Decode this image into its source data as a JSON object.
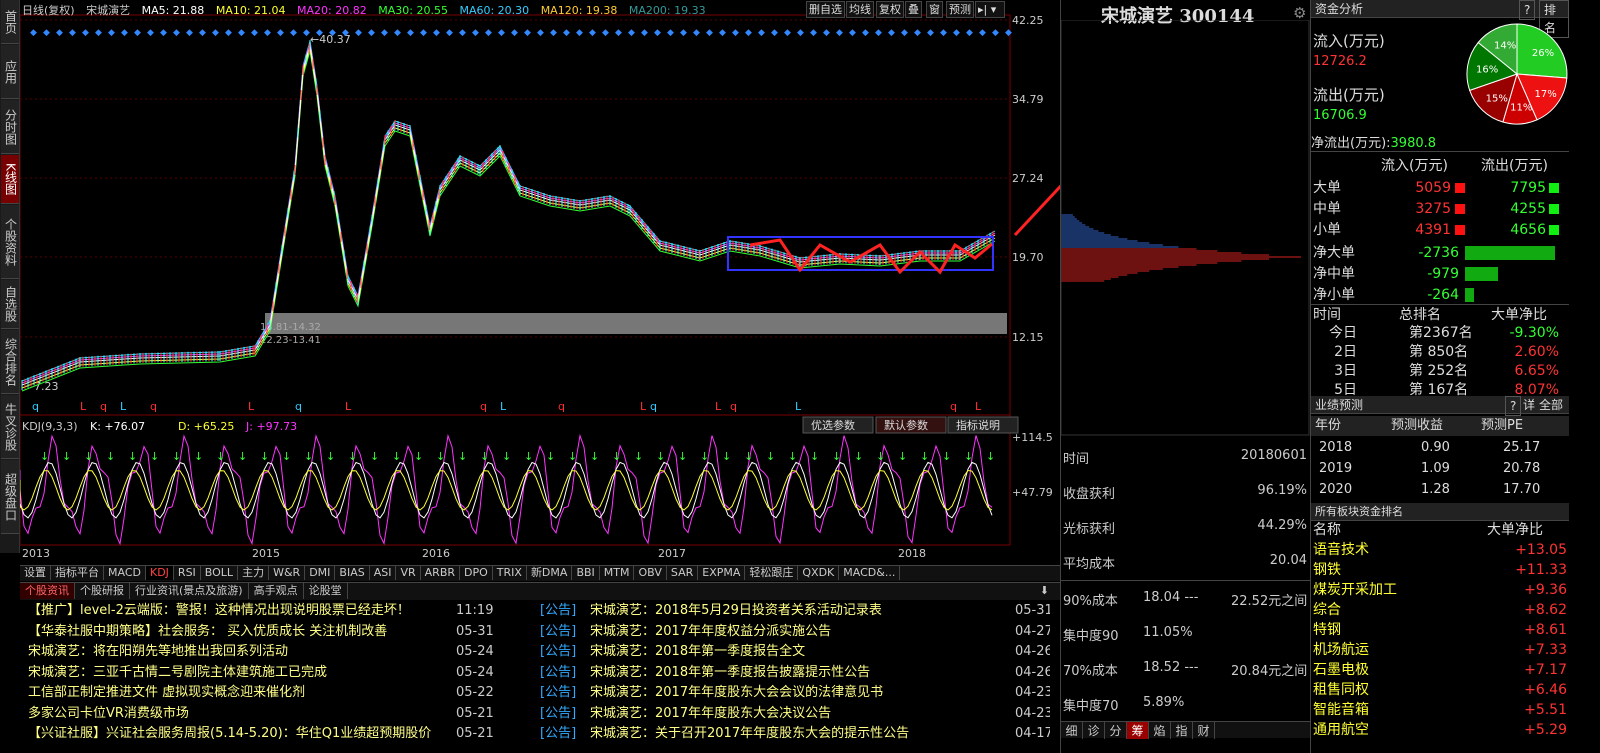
{
  "nav": [
    "首页",
    "应用",
    "分时图",
    "K线图",
    "个股资料",
    "自选股",
    "综合排名",
    "牛叉诊股",
    "超级盘口"
  ],
  "header": {
    "period": "日线(复权)",
    "name": "宋城演艺",
    "ma5": "MA5: 21.88",
    "ma10": "MA10: 21.04",
    "ma20": "MA20: 20.82",
    "ma30": "MA30: 20.55",
    "ma60": "MA60: 20.30",
    "ma120": "MA120: 19.38",
    "ma200": "MA200: 19.33"
  },
  "toolbar": [
    "删自选",
    "均线",
    "复权",
    "叠",
    "窗",
    "预测"
  ],
  "yaxis": [
    "42.25",
    "34.79",
    "27.24",
    "19.70",
    "12.15"
  ],
  "ylabels": {
    "high": "40.37",
    "low": "7.23",
    "gap1": "13.81-14.32",
    "gap2": "12.23-13.41"
  },
  "xaxis": [
    "2013",
    "2015",
    "2016",
    "2017",
    "2018"
  ],
  "kdj": {
    "title": "KDJ(9,3,3)",
    "k": "K: +76.07",
    "d": "D: +65.25",
    "j": "J: +97.73",
    "y1": "+114.5",
    "y2": "+47.79",
    "btn1": "优选参数",
    "btn2": "默认参数",
    "btn3": "指标说明"
  },
  "tabs": [
    "设置",
    "指标平台",
    "MACD",
    "KDJ",
    "RSI",
    "BOLL",
    "主力",
    "W&R",
    "DMI",
    "BIAS",
    "ASI",
    "VR",
    "ARBR",
    "DPO",
    "TRIX",
    "新DMA",
    "BBI",
    "MTM",
    "OBV",
    "SAR",
    "EXPMA",
    "轻松跟庄",
    "QXDK",
    "MACD&..."
  ],
  "newstabs": [
    "个股资讯",
    "个股研报",
    "行业资讯(景点及旅游)",
    "高手观点",
    "论股堂"
  ],
  "news_left": [
    {
      "title": "【推广】level-2云端版：警报！这种情况出现说明股票已经走坏！",
      "time": "11:19"
    },
    {
      "title": "【华泰社服中期策略】社会服务： 买入优质成长 关注机制改善",
      "time": "05-31"
    },
    {
      "title": "宋城演艺：将在阳朔先等地推出我回系列活动",
      "time": "05-24"
    },
    {
      "title": "宋城演艺：三亚千古情二号剧院主体建筑施工已完成",
      "time": "05-24"
    },
    {
      "title": "工信部正制定推进文件 虚拟现实概念迎来催化剂",
      "time": "05-22"
    },
    {
      "title": "多家公司卡位VR消费级市场",
      "time": "05-21"
    },
    {
      "title": "【兴证社服】兴证社会服务周报(5.14-5.20)：华住Q1业绩超预期股价",
      "time": "05-21"
    }
  ],
  "news_right": [
    {
      "tag": "[公告]",
      "title": "宋城演艺：2018年5月29日投资者关系活动记录表",
      "date": "05-31"
    },
    {
      "tag": "[公告]",
      "title": "宋城演艺：2017年年度权益分派实施公告",
      "date": "04-27"
    },
    {
      "tag": "[公告]",
      "title": "宋城演艺：2018年第一季度报告全文",
      "date": "04-26"
    },
    {
      "tag": "[公告]",
      "title": "宋城演艺：2018年第一季度报告披露提示性公告",
      "date": "04-26"
    },
    {
      "tag": "[公告]",
      "title": "宋城演艺：2017年年度股东大会会议的法律意见书",
      "date": "04-23"
    },
    {
      "tag": "[公告]",
      "title": "宋城演艺：2017年年度股东大会决议公告",
      "date": "04-23"
    },
    {
      "tag": "[公告]",
      "title": "宋城演艺：关于召开2017年年度股东大会的提示性公告",
      "date": "04-17"
    }
  ],
  "mid": {
    "title": "宋城演艺 300144",
    "stats": [
      {
        "k": "时间",
        "v": "20180601"
      },
      {
        "k": "收盘获利",
        "v": "96.19%"
      },
      {
        "k": "光标获利",
        "v": "44.29%"
      },
      {
        "k": "平均成本",
        "v": "20.04"
      }
    ],
    "cost90": {
      "k": "90%成本",
      "a": "18.04 ---",
      "b": "22.52元之间"
    },
    "conc90": {
      "k": "集中度90",
      "v": "11.05%"
    },
    "cost70": {
      "k": "70%成本",
      "a": "18.52 ---",
      "b": "20.84元之间"
    },
    "conc70": {
      "k": "集中度70",
      "v": "5.89%"
    },
    "bottabs": [
      "细",
      "诊",
      "分",
      "筹",
      "焰",
      "指",
      "财"
    ]
  },
  "fund": {
    "head": "资金分析",
    "help": "?",
    "rank": "排名",
    "inflow_label": "流入(万元)",
    "inflow": "12726.2",
    "outflow_label": "流出(万元)",
    "outflow": "16706.9",
    "net_label": "净流出(万元):",
    "net": "3980.8",
    "pie": [
      {
        "label": "26%",
        "color": "#22cc22"
      },
      {
        "label": "17%",
        "color": "#ee1111"
      },
      {
        "label": "11%",
        "color": "#cc0000"
      },
      {
        "label": "15%",
        "color": "#990000"
      },
      {
        "label": "16%",
        "color": "#007700"
      },
      {
        "label": "14%",
        "color": "#33aa33"
      }
    ],
    "col_in": "流入(万元)",
    "col_out": "流出(万元)",
    "rows": [
      {
        "k": "大单",
        "in": "5059",
        "out": "7795"
      },
      {
        "k": "中单",
        "in": "3275",
        "out": "4255"
      },
      {
        "k": "小单",
        "in": "4391",
        "out": "4656"
      }
    ],
    "net_rows": [
      {
        "k": "净大单",
        "v": "-2736",
        "bar": 0.9
      },
      {
        "k": "净中单",
        "v": "-979",
        "bar": 0.33
      },
      {
        "k": "净小单",
        "v": "-264",
        "bar": 0.09
      }
    ],
    "rank_head": {
      "a": "时间",
      "b": "总排名",
      "c": "大单净比"
    },
    "ranks": [
      {
        "k": "今日",
        "n": "第2367名",
        "p": "-9.30%"
      },
      {
        "k": "2日",
        "n": "第 850名",
        "p": "2.60%"
      },
      {
        "k": "3日",
        "n": "第 252名",
        "p": "6.65%"
      },
      {
        "k": "5日",
        "n": "第 167名",
        "p": "8.07%"
      }
    ]
  },
  "forecast": {
    "head": "业绩预测",
    "help": "?",
    "detail": "详",
    "all": "全部",
    "cols": [
      "年份",
      "预测收益",
      "预测PE"
    ],
    "rows": [
      [
        "2018",
        "0.90",
        "25.17"
      ],
      [
        "2019",
        "1.09",
        "20.78"
      ],
      [
        "2020",
        "1.28",
        "17.70"
      ]
    ]
  },
  "sector": {
    "head": "所有板块资金排名",
    "col1": "名称",
    "col2": "大单净比",
    "rows": [
      [
        "语音技术",
        "+13.05"
      ],
      [
        "钢铁",
        "+11.33"
      ],
      [
        "煤炭开采加工",
        "+9.36"
      ],
      [
        "综合",
        "+8.62"
      ],
      [
        "特钢",
        "+8.61"
      ],
      [
        "机场航运",
        "+7.33"
      ],
      [
        "石墨电极",
        "+7.17"
      ],
      [
        "租售同权",
        "+6.46"
      ],
      [
        "智能音箱",
        "+5.51"
      ],
      [
        "通用航空",
        "+5.29"
      ]
    ]
  }
}
